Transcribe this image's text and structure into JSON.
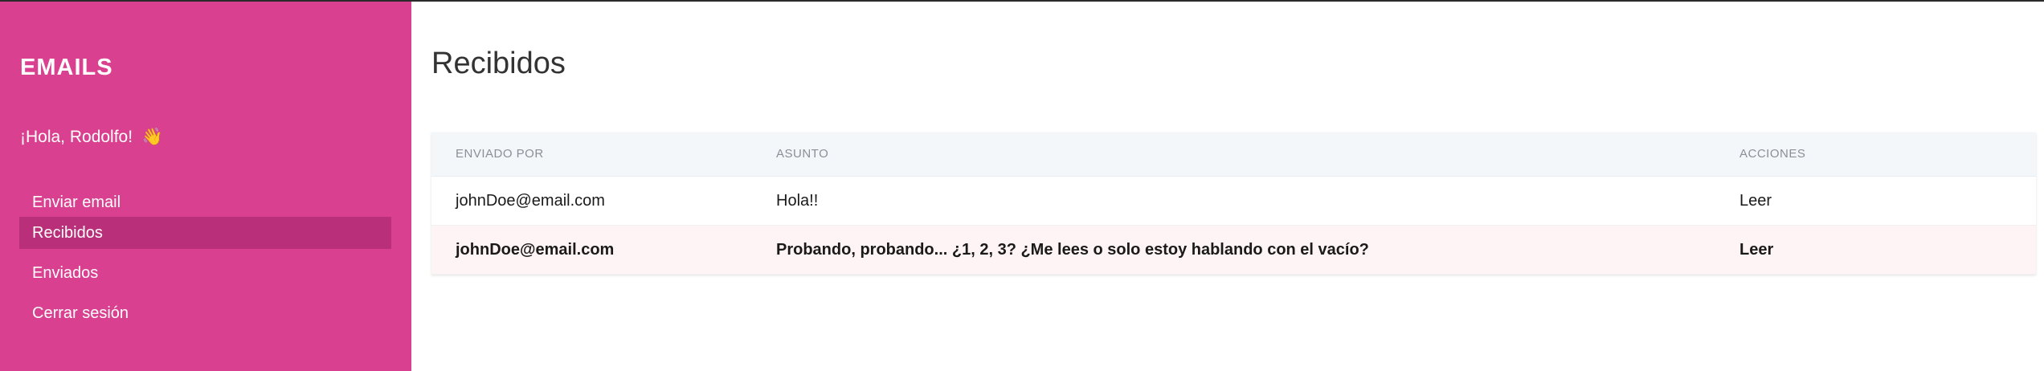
{
  "sidebar": {
    "brand": "EMAILS",
    "greeting": "¡Hola, Rodolfo!",
    "greeting_emoji": "👋",
    "items": [
      {
        "label": "Enviar email",
        "active": false
      },
      {
        "label": "Recibidos",
        "active": true
      },
      {
        "label": "Enviados",
        "active": false
      },
      {
        "label": "Cerrar sesión",
        "active": false
      }
    ]
  },
  "main": {
    "title": "Recibidos",
    "table": {
      "headers": [
        "ENVIADO POR",
        "ASUNTO",
        "ACCIONES"
      ],
      "rows": [
        {
          "from": "johnDoe@email.com",
          "subject": "Hola!!",
          "action": "Leer",
          "unread": false
        },
        {
          "from": "johnDoe@email.com",
          "subject": "Probando, probando... ¿1, 2, 3? ¿Me lees o solo estoy hablando con el vacío?",
          "action": "Leer",
          "unread": true
        }
      ]
    }
  },
  "colors": {
    "sidebar_bg": "#d9408f",
    "sidebar_active": "#b92f79",
    "header_bg": "#f4f7fa",
    "unread_row_bg": "#fff4f5"
  }
}
